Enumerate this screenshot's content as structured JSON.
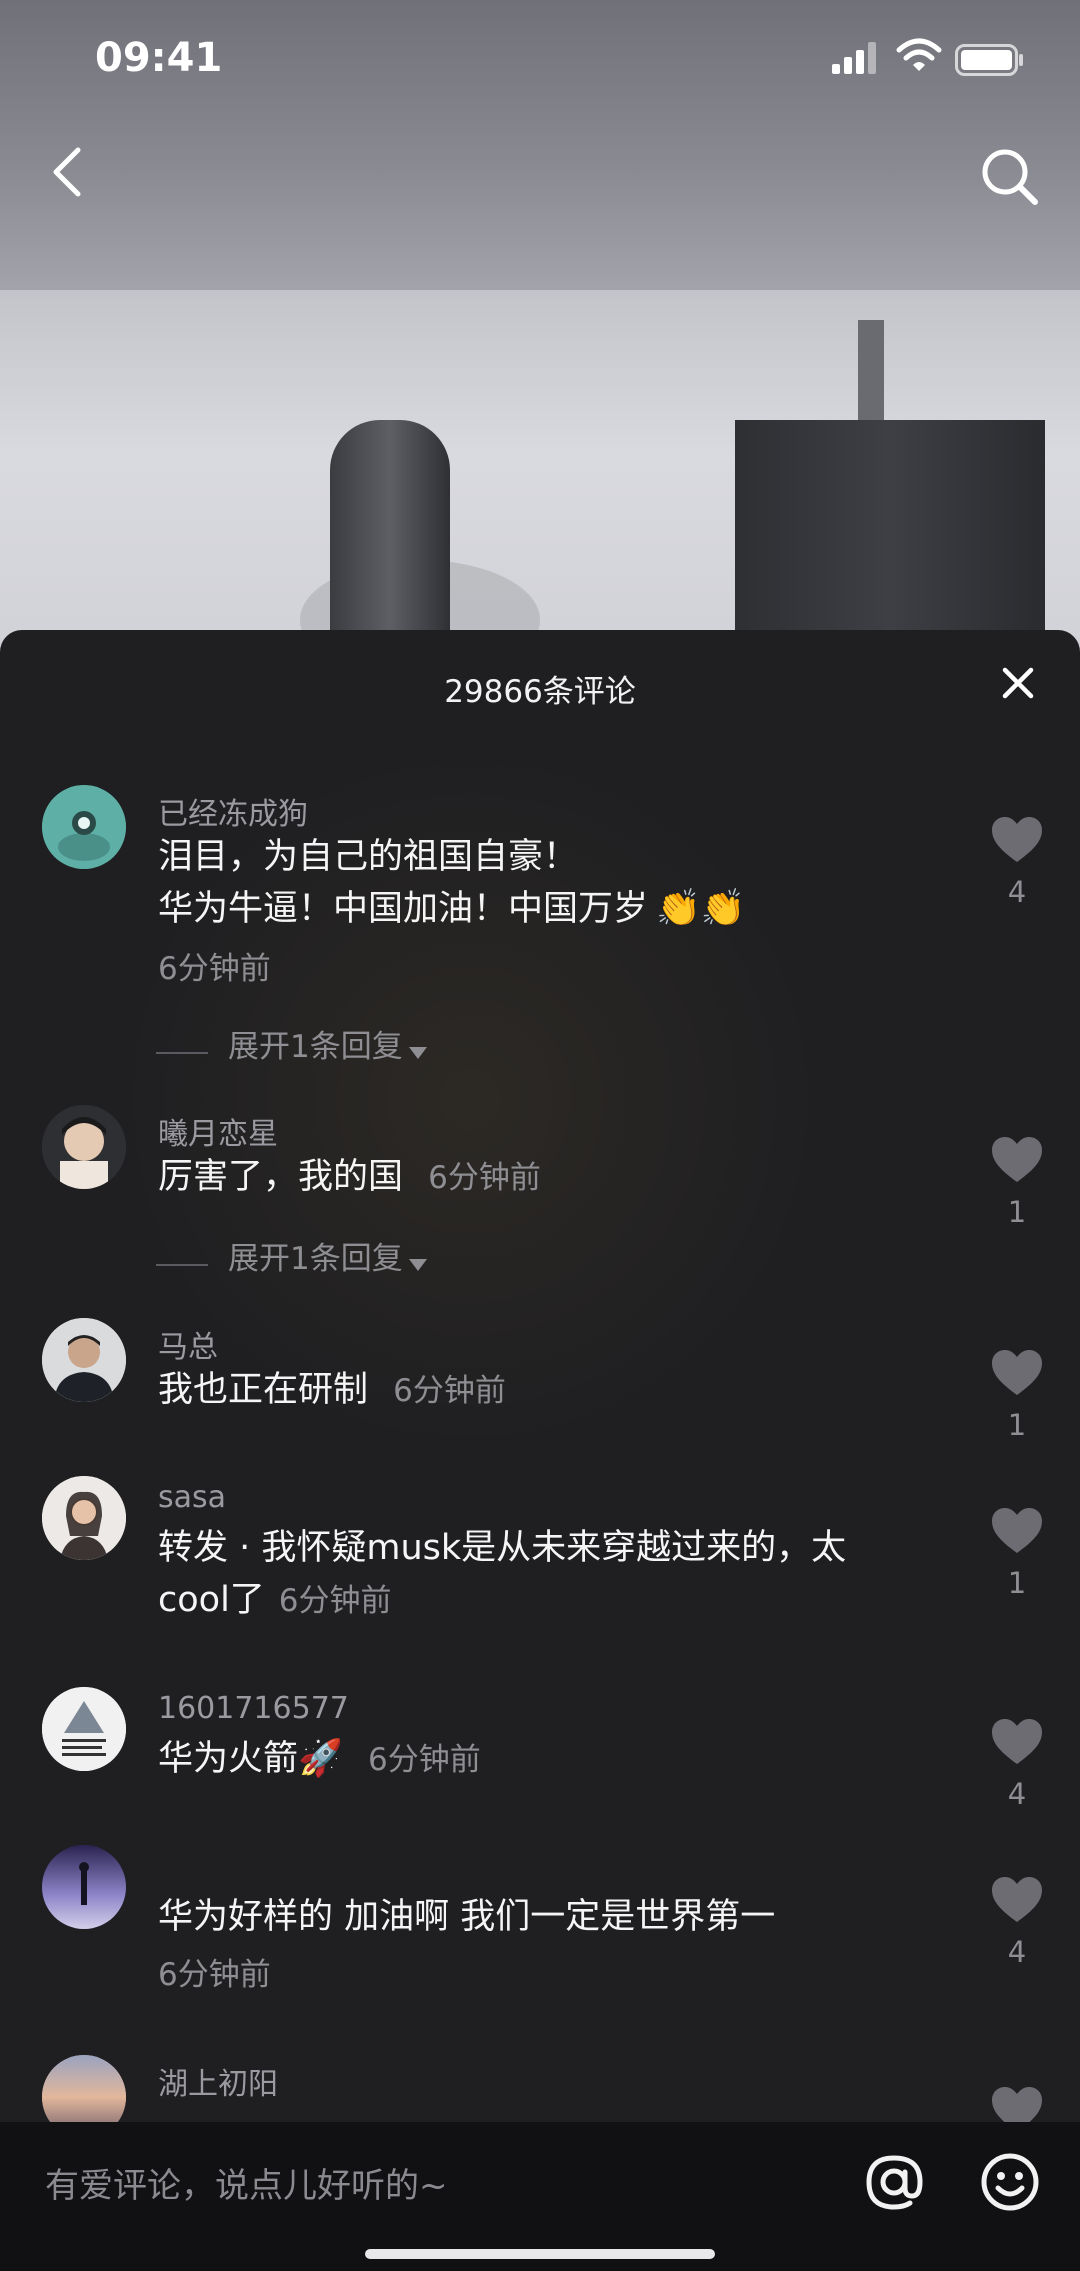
{
  "status_bar": {
    "time": "09:41"
  },
  "sheet": {
    "title": "29866条评论"
  },
  "comments": [
    {
      "name": "已经冻成狗",
      "line1": "泪目，为自己的祖国自豪！",
      "line2": "华为牛逼！中国加油！中国万岁",
      "time": "6分钟前",
      "likes": "4",
      "expand": "展开1条回复"
    },
    {
      "name": "曦月恋星",
      "text": "厉害了，我的国",
      "time": "6分钟前",
      "likes": "1",
      "expand": "展开1条回复"
    },
    {
      "name": "马总",
      "text": "我也正在研制",
      "time": "6分钟前",
      "likes": "1"
    },
    {
      "name": "sasa",
      "line1": "转发 · 我怀疑musk是从未来穿越过来的，太",
      "line2": "cool了",
      "time": "6分钟前",
      "likes": "1"
    },
    {
      "name": "1601716577",
      "text": "华为火箭",
      "time": "6分钟前",
      "likes": "4"
    },
    {
      "name": "",
      "text": "华为好样的 加油啊 我们一定是世界第一",
      "time": "6分钟前",
      "likes": "4"
    },
    {
      "name": "湖上初阳"
    }
  ],
  "input": {
    "placeholder": "有爱评论，说点儿好听的~"
  },
  "icons": [
    "back-arrow-icon",
    "search-icon",
    "close-icon",
    "heart-icon",
    "at-icon",
    "emoji-icon",
    "clap-emoji-icon",
    "rocket-emoji-icon"
  ]
}
